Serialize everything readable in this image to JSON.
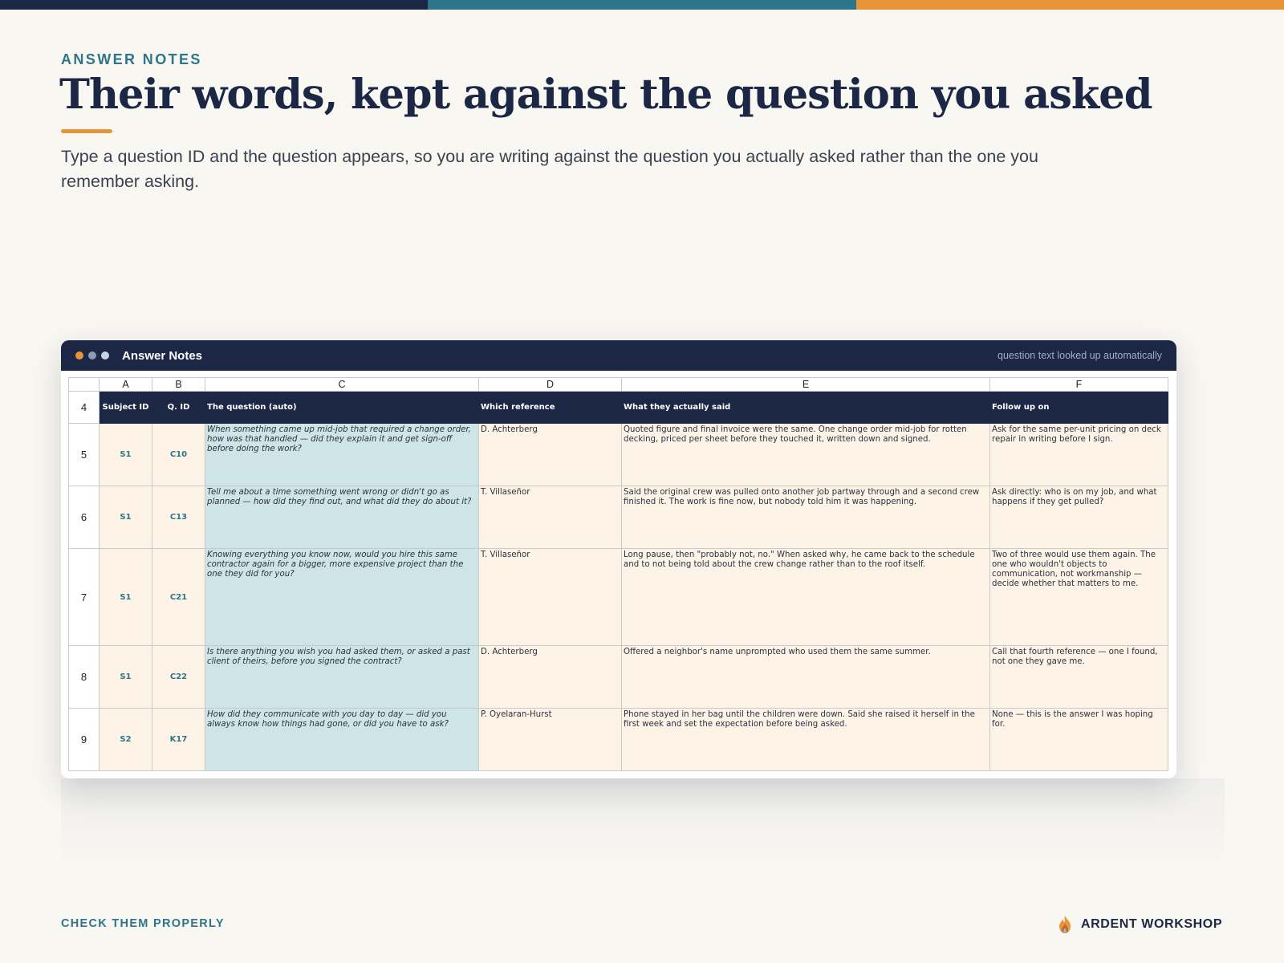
{
  "colors": {
    "navy": "#1b2745",
    "teal": "#2d7589",
    "orange": "#e8943a",
    "cream": "#fdf3e6",
    "question_fill": "#cde5e6",
    "grey_dot": "#9fb0c8"
  },
  "header": {
    "eyebrow": "ANSWER NOTES",
    "title": "Their words, kept against the question you asked",
    "lede": "Type a question ID and the question appears, so you are writing against the question you actually asked rather than the one you remember asking."
  },
  "window": {
    "title": "Answer Notes",
    "note": "question text looked up automatically"
  },
  "sheet": {
    "columns": [
      "A",
      "B",
      "C",
      "D",
      "E",
      "F"
    ],
    "header_row": {
      "number": "4",
      "cells": [
        "Subject ID",
        "Q. ID",
        "The question (auto)",
        "Which reference",
        "What they actually said",
        "Follow up on"
      ]
    },
    "rows": [
      {
        "number": "5",
        "subject": "S1",
        "qid": "C10",
        "question": "When something came up mid-job that required a change order, how was that handled — did they explain it and get sign-off before doing the work?",
        "reference": "D. Achterberg",
        "said": "Quoted figure and final invoice were the same. One change order mid-job for rotten decking, priced per sheet before they touched it, written down and signed.",
        "follow": "Ask for the same per-unit pricing on deck repair in writing before I sign."
      },
      {
        "number": "6",
        "subject": "S1",
        "qid": "C13",
        "question": "Tell me about a time something went wrong or didn't go as planned — how did they find out, and what did they do about it?",
        "reference": "T. Villaseñor",
        "said": "Said the original crew was pulled onto another job partway through and a second crew finished it. The work is fine now, but nobody told him it was happening.",
        "follow": "Ask directly: who is on my job, and what happens if they get pulled?"
      },
      {
        "number": "7",
        "subject": "S1",
        "qid": "C21",
        "question": "Knowing everything you know now, would you hire this same contractor again for a bigger, more expensive project than the one they did for you?",
        "reference": "T. Villaseñor",
        "said": "Long pause, then \"probably not, no.\" When asked why, he came back to the schedule and to not being told about the crew change rather than to the roof itself.",
        "follow": "Two of three would use them again. The one who wouldn't objects to communication, not workmanship — decide whether that matters to me."
      },
      {
        "number": "8",
        "subject": "S1",
        "qid": "C22",
        "question": "Is there anything you wish you had asked them, or asked a past client of theirs, before you signed the contract?",
        "reference": "D. Achterberg",
        "said": "Offered a neighbor's name unprompted who used them the same summer.",
        "follow": "Call that fourth reference — one I found, not one they gave me."
      },
      {
        "number": "9",
        "subject": "S2",
        "qid": "K17",
        "question": "How did they communicate with you day to day — did you always know how things had gone, or did you have to ask?",
        "reference": "P. Oyelaran-Hurst",
        "said": "Phone stayed in her bag until the children were down. Said she raised it herself in the first week and set the expectation before being asked.",
        "follow": "None — this is the answer I was hoping for."
      }
    ]
  },
  "footer": {
    "left": "CHECK THEM PROPERLY",
    "brand": "ARDENT WORKSHOP",
    "brand_icon": "flame-icon"
  }
}
